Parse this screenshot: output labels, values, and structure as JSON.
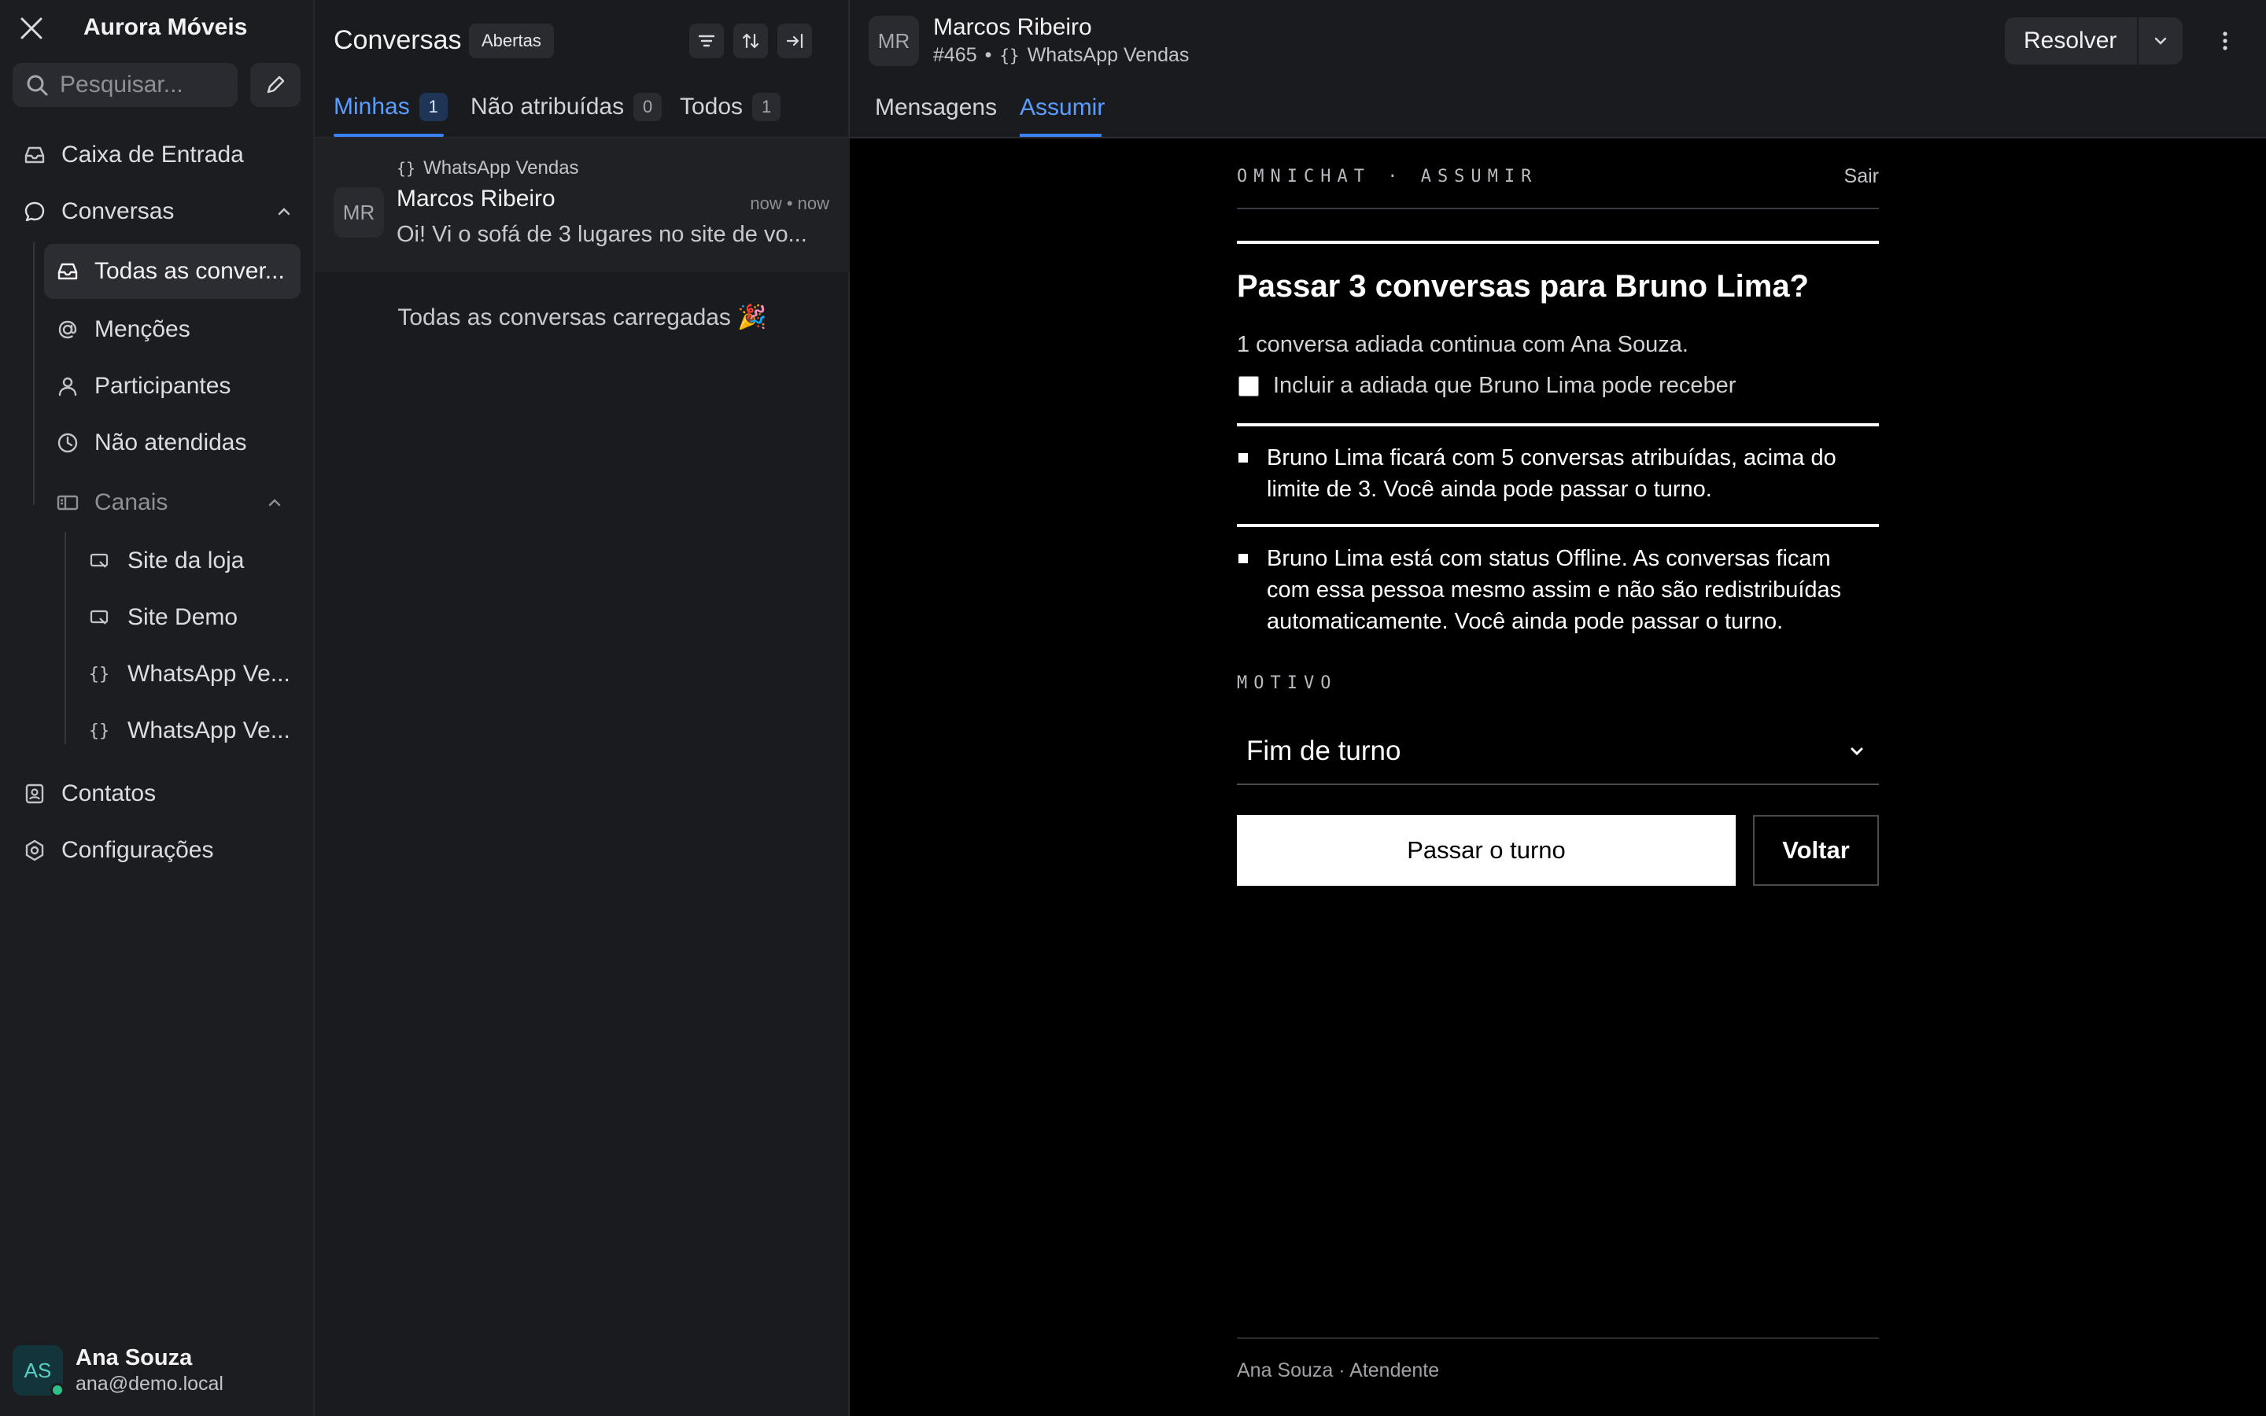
{
  "sidebar": {
    "account_name": "Aurora Móveis",
    "search_placeholder": "Pesquisar...",
    "nav": {
      "inbox": "Caixa de Entrada",
      "conversations": "Conversas",
      "all_conversations": "Todas as conver...",
      "mentions": "Menções",
      "participants": "Participantes",
      "unattended": "Não atendidas",
      "channels": "Canais",
      "channel_items": [
        "Site da loja",
        "Site Demo",
        "WhatsApp Ve...",
        "WhatsApp Ve..."
      ],
      "contacts": "Contatos",
      "settings": "Configurações"
    },
    "user": {
      "initials": "AS",
      "name": "Ana Souza",
      "email": "ana@demo.local"
    }
  },
  "conversation_list": {
    "title": "Conversas",
    "status_badge": "Abertas",
    "tabs": [
      {
        "label": "Minhas",
        "count": "1"
      },
      {
        "label": "Não atribuídas",
        "count": "0"
      },
      {
        "label": "Todos",
        "count": "1"
      }
    ],
    "card": {
      "inbox": "WhatsApp Vendas",
      "initials": "MR",
      "name": "Marcos Ribeiro",
      "time": "now • now",
      "preview": "Oi! Vi o sofá de 3 lugares no site de vo..."
    },
    "loaded_text": "Todas as conversas carregadas 🎉"
  },
  "header": {
    "initials": "MR",
    "name": "Marcos Ribeiro",
    "id": "#465",
    "bullet": "•",
    "inbox": "WhatsApp Vendas",
    "resolve_label": "Resolver",
    "tabs": [
      "Mensagens",
      "Assumir"
    ]
  },
  "takeover": {
    "eyebrow": "OMNICHAT · ASSUMIR",
    "exit": "Sair",
    "title": "Passar 3 conversas para Bruno Lima?",
    "subtitle": "1 conversa adiada continua com Ana Souza.",
    "checkbox_label": "Incluir a adiada que Bruno Lima pode receber",
    "warning_limit": "Bruno Lima ficará com 5 conversas atribuídas, acima do limite de 3. Você ainda pode passar o turno.",
    "warning_offline": "Bruno Lima está com status Offline. As conversas ficam com essa pessoa mesmo assim e não são redistribuídas automaticamente. Você ainda pode passar o turno.",
    "reason_label": "MOTIVO",
    "reason_value": "Fim de turno",
    "confirm_label": "Passar o turno",
    "back_label": "Voltar",
    "footer": "Ana Souza · Atendente"
  },
  "colors": {
    "accent": "#3b82f6",
    "sidebar_bg": "#1c1d20",
    "list_bg": "#1a1b1e",
    "main_bg": "#000000",
    "online": "#2fbf8b"
  }
}
